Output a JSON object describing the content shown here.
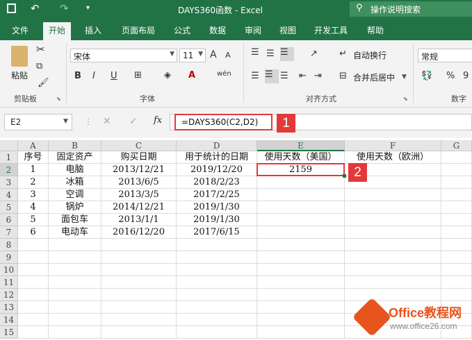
{
  "window": {
    "title": "DAYS360函数  -  Excel",
    "tell_me": "操作说明搜索"
  },
  "quick_access": {
    "icons": [
      "save-icon",
      "undo-icon",
      "redo-icon",
      "customize-icon"
    ]
  },
  "tabs": [
    "文件",
    "开始",
    "插入",
    "页面布局",
    "公式",
    "数据",
    "审阅",
    "视图",
    "开发工具",
    "帮助"
  ],
  "active_tab": "开始",
  "ribbon": {
    "clipboard": {
      "paste": "粘贴",
      "label": "剪贴板"
    },
    "font": {
      "name": "宋体",
      "size": "11",
      "label": "字体",
      "grow": "A",
      "shrink": "A",
      "bold": "B",
      "italic": "I",
      "underline": "U",
      "color_letter": "A",
      "wen": "wén"
    },
    "alignment": {
      "wrap": "自动换行",
      "merge": "合并后居中",
      "label": "对齐方式"
    },
    "number": {
      "format": "常规",
      "percent": "%",
      "comma": "9",
      "label": "数字"
    }
  },
  "formula_bar": {
    "name_box": "E2",
    "fx": "fx",
    "cancel": "✕",
    "enter": "✓",
    "formula": "=DAYS360(C2,D2)"
  },
  "callouts": [
    "1",
    "2"
  ],
  "sheet": {
    "columns": [
      "A",
      "B",
      "C",
      "D",
      "E",
      "F",
      "G"
    ],
    "rows": [
      "1",
      "2",
      "3",
      "4",
      "5",
      "6",
      "7",
      "8",
      "9",
      "10",
      "11",
      "12",
      "13",
      "14",
      "15"
    ],
    "data": [
      [
        "序号",
        "固定资产",
        "购买日期",
        "用于统计的日期",
        "使用天数（美国）",
        "使用天数（欧洲）"
      ],
      [
        "1",
        "电脑",
        "2013/12/21",
        "2019/12/20",
        "2159",
        ""
      ],
      [
        "2",
        "冰箱",
        "2013/6/5",
        "2018/2/23",
        "",
        ""
      ],
      [
        "3",
        "空调",
        "2013/3/5",
        "2017/2/25",
        "",
        ""
      ],
      [
        "4",
        "锅炉",
        "2014/12/21",
        "2019/1/30",
        "",
        ""
      ],
      [
        "5",
        "面包车",
        "2013/1/1",
        "2019/1/30",
        "",
        ""
      ],
      [
        "6",
        "电动车",
        "2016/12/20",
        "2017/6/15",
        "",
        ""
      ]
    ]
  },
  "watermark": {
    "brand": "Office教程网",
    "url": "www.office26.com"
  },
  "colors": {
    "excel_green": "#217346",
    "callout_red": "#e2393b",
    "selection_red": "#e2393b"
  }
}
